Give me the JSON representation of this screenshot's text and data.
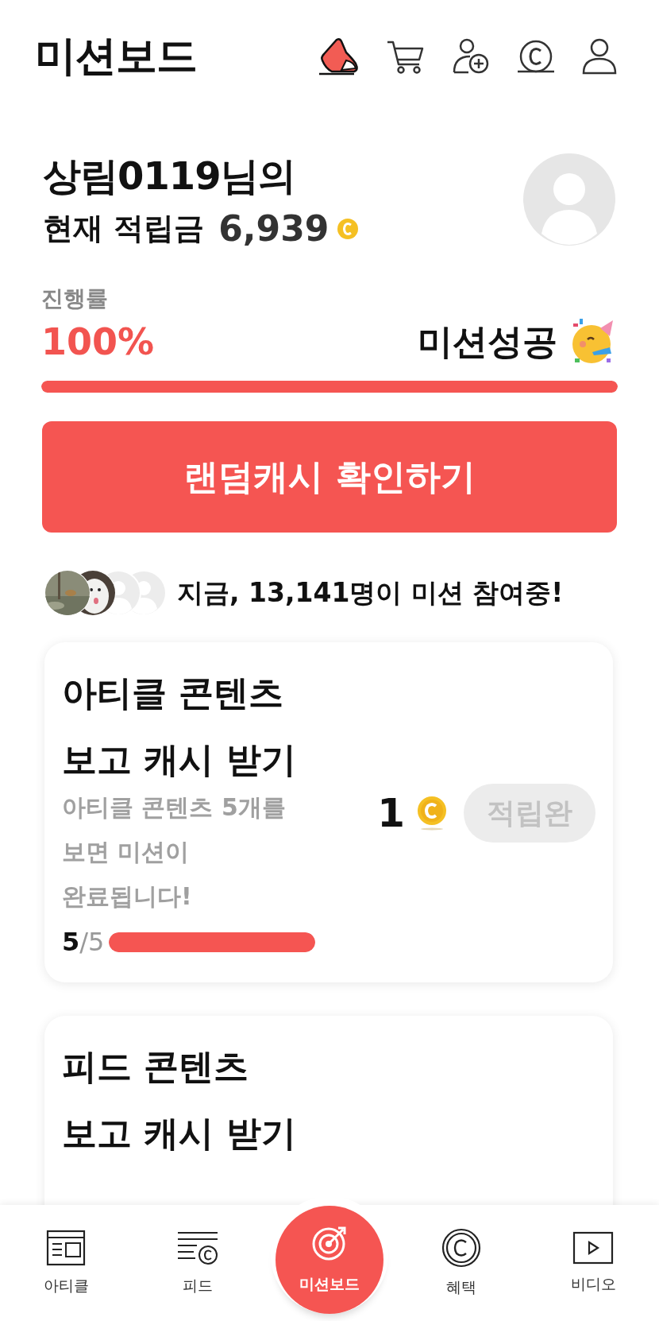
{
  "header": {
    "title": "미션보드"
  },
  "summary": {
    "greeting": "상림0119님의",
    "balance_label": "현재 적립금",
    "balance": "6,939"
  },
  "progress": {
    "label": "진행률",
    "value": "100%",
    "status": "미션성공",
    "level": 1
  },
  "action_button": {
    "label": "랜덤캐시 확인하기"
  },
  "participants": {
    "avatars": [
      {
        "kind": "picture"
      },
      {
        "kind": "picture"
      },
      {
        "kind": "placeholder"
      },
      {
        "kind": "placeholder"
      }
    ],
    "text": "지금, 13,141명이 미션 참여중!"
  },
  "missions": [
    {
      "title_lines": [
        "아티클 콘텐츠",
        "보고 캐시 받기"
      ],
      "description_lines": [
        "아티클 콘텐츠 5개를",
        "보면 미션이",
        "완료됩니다!"
      ],
      "count": "5",
      "total": "/5",
      "level": 1,
      "reward": "1",
      "status": "적립완",
      "completed": true
    },
    {
      "title_lines": [
        "피드 콘텐츠",
        "보고 캐시 받기"
      ]
    }
  ],
  "nav": [
    {
      "label": "아티클",
      "kind": "article",
      "selected": false
    },
    {
      "label": "피드",
      "kind": "feed",
      "selected": false
    },
    {
      "label": "미션보드",
      "kind": "mission",
      "selected": true
    },
    {
      "label": "혜택",
      "kind": "benefit",
      "selected": false
    },
    {
      "label": "비디오",
      "kind": "video",
      "selected": false
    }
  ]
}
